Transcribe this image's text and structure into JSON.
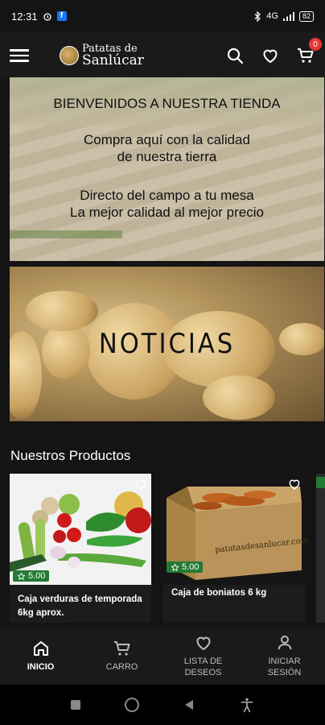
{
  "status": {
    "time": "12:31",
    "signal": "4G",
    "battery": "82"
  },
  "header": {
    "logo_line1": "Patatas de",
    "logo_line2": "Sanlúcar",
    "cart_count": "0"
  },
  "banner_welcome": {
    "line1": "BIENVENIDOS A NUESTRA TIENDA",
    "line2": "Compra aquí con la calidad",
    "line3": "de nuestra tierra",
    "line4": "Directo del campo a tu mesa",
    "line5": "La mejor calidad al mejor precio"
  },
  "banner_news": {
    "title": "NOTICIAS"
  },
  "products_section": {
    "title": "Nuestros Productos"
  },
  "products": [
    {
      "title": "Caja verduras de temporada 6kg aprox.",
      "rating": "5.00"
    },
    {
      "title": "Caja de boniatos 6 kg",
      "rating": "5.00"
    }
  ],
  "box_print": "patatasdesanlucar.com",
  "bottom_nav": {
    "home": "INICIO",
    "cart": "CARRO",
    "wishlist": "LISTA DE\nDESEOS",
    "login": "INICIAR\nSESIÓN"
  },
  "colors": {
    "accent_green": "#237a35",
    "badge_red": "#e53935",
    "background": "#141414"
  },
  "icons": [
    "menu-icon",
    "search-icon",
    "heart-icon",
    "cart-icon",
    "home-icon",
    "user-icon",
    "star-icon"
  ]
}
